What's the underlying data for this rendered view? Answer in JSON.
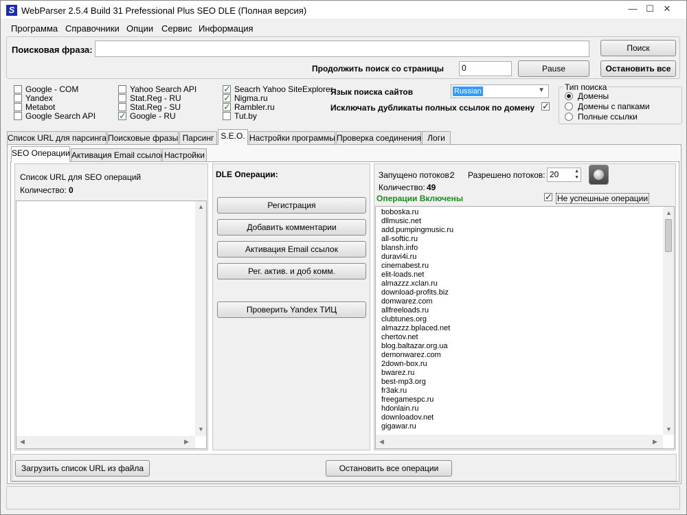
{
  "window": {
    "title": "WebParser 2.5.4 Build 31 Prefessional Plus SEO DLE (Полная версия)",
    "min": "—",
    "max": "☐",
    "close": "✕"
  },
  "menu": [
    "Программа",
    "Справочники",
    "Опции",
    "Сервис",
    "Информация"
  ],
  "search": {
    "label": "Поисковая фраза:",
    "value": "",
    "search_button": "Поиск",
    "continue_label": "Продолжить поиск со страницы",
    "page_value": "0",
    "pause_button": "Pause",
    "stop_all_button": "Остановить все"
  },
  "engines": {
    "col1": [
      {
        "label": "Google - COM",
        "checked": false
      },
      {
        "label": "Yandex",
        "checked": false
      },
      {
        "label": "Metabot",
        "checked": false
      },
      {
        "label": "Google Search API",
        "checked": false
      }
    ],
    "col2": [
      {
        "label": "Yahoo Search API",
        "checked": false
      },
      {
        "label": "Stat.Reg - RU",
        "checked": false
      },
      {
        "label": "Stat.Reg - SU",
        "checked": false
      },
      {
        "label": "Google - RU",
        "checked": true
      }
    ],
    "col3": [
      {
        "label": "Seacrh Yahoo SiteExplorer",
        "checked": true
      },
      {
        "label": "Nigma.ru",
        "checked": true
      },
      {
        "label": "Rambler.ru",
        "checked": true
      },
      {
        "label": "Tut.by",
        "checked": false
      }
    ]
  },
  "language": {
    "label": "Язык поиска сайтов",
    "value": "Russian"
  },
  "exclude_dupes": {
    "label": "Исключать дубликаты полных ссылок по домену",
    "checked": true
  },
  "search_type": {
    "legend": "Тип поиска",
    "options": [
      {
        "label": "Домены",
        "checked": true
      },
      {
        "label": "Домены с папками",
        "checked": false
      },
      {
        "label": "Полные ссылки",
        "checked": false
      }
    ]
  },
  "tabs": [
    "Список URL для парсинга",
    "Поисковые фразы",
    "Парсинг",
    "S.E.O.",
    "Настройки программы",
    "Проверка соединения",
    "Логи"
  ],
  "subtabs": [
    "SEO Операции",
    "Активация Email ссылок",
    "Настройки"
  ],
  "left_panel": {
    "title": "Список URL для SEO операций",
    "count_label": "Количество:",
    "count_value": "0"
  },
  "dle": {
    "title": "DLE Операции:",
    "buttons": [
      "Регистрация",
      "Добавить комментарии",
      "Активация Email ссылок",
      "Рег. актив. и доб комм.",
      "Проверить Yandex ТИЦ"
    ]
  },
  "right_panel": {
    "threads_running_label": "Запущено потоков:",
    "threads_running_value": "2",
    "threads_allowed_label": "Разрешено потоков:",
    "threads_allowed_value": "20",
    "count_label": "Количество:",
    "count_value": "49",
    "ops_enabled": "Операции Включены",
    "failed_ops_label": "Не успешные операции",
    "failed_ops_checked": true,
    "urls": [
      "boboska.ru",
      "dllmusic.net",
      "add.pumpingmusic.ru",
      "all-softic.ru",
      "blansh.info",
      "duravi4i.ru",
      "cinemabest.ru",
      "elit-loads.net",
      "almazzz.xclan.ru",
      "download-profits.biz",
      "domwarez.com",
      "allfreeloads.ru",
      "clubtunes.org",
      "almazzz.bplaced.net",
      "chertov.net",
      "blog.baltazar.org.ua",
      "demonwarez.com",
      "2down-box.ru",
      "bwarez.ru",
      "best-mp3.org",
      "fr3ak.ru",
      "freegamespc.ru",
      "hdonlain.ru",
      "downloadov.net",
      "gigawar.ru"
    ]
  },
  "bottom": {
    "load_button": "Загрузить список URL из файла",
    "stop_ops_button": "Остановить все операции"
  }
}
